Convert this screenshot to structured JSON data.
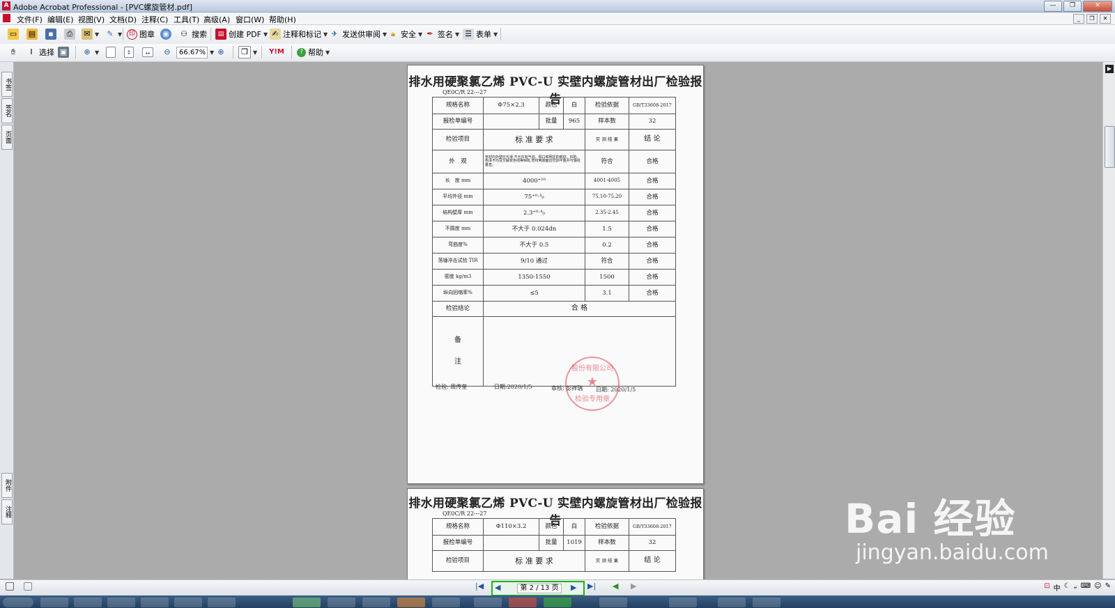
{
  "window": {
    "title": "Adobe Acrobat Professional - [PVC螺旋管材.pdf]"
  },
  "menu": [
    "文件(F)",
    "编辑(E)",
    "视图(V)",
    "文档(D)",
    "注释(C)",
    "工具(T)",
    "高级(A)",
    "窗口(W)",
    "帮助(H)"
  ],
  "toolbar1": {
    "stamp": "图章",
    "search": "搜索",
    "create_pdf": "创建 PDF",
    "comment": "注释和标记",
    "send_review": "发送供审阅",
    "security": "安全",
    "sign": "签名",
    "forms": "表单"
  },
  "toolbar2": {
    "select": "选择",
    "zoom": "66.67%",
    "help": "帮助"
  },
  "side_tabs": [
    "书签",
    "签名",
    "页面",
    "附件",
    "注释"
  ],
  "report1": {
    "title": "排水用硬聚氯乙烯 PVC-U 实壁内螺旋管材出厂检验报告",
    "code": "QE0C/R 22---27",
    "spec_label": "规格名称",
    "spec": "Φ75×2.3",
    "color_label": "颜色",
    "color": "白",
    "basis_label": "检验依据",
    "basis": "GB/T33608-2017",
    "form_no_label": "报检单编号",
    "batch_label": "批量",
    "batch": "965",
    "sample_label": "样本数",
    "sample": "32",
    "h_item": "检验项目",
    "h_req": "标 准 要 求",
    "h_result": "实 测 结 果",
    "h_conc": "结 论",
    "rows": [
      {
        "item": "外　观",
        "req": "管材内外壁应光滑,不允许有气泡、裂口和明显的痕纹、凹陷、色泽不均及分解变色线等缺陷,管材两端面应切割平整并与轴线垂直。",
        "result": "符合",
        "conc": "合格"
      },
      {
        "item": "长　度 mm",
        "req": "4000⁺¹⁰",
        "result": "4001-4005",
        "conc": "合格"
      },
      {
        "item": "平均外径 mm",
        "req": "75⁺⁰·³₀",
        "result": "75.10-75.20",
        "conc": "合格"
      },
      {
        "item": "结构壁厚 mm",
        "req": "2.3⁺⁰·⁴₀",
        "result": "2.35-2.45",
        "conc": "合格"
      },
      {
        "item": "不圆度 mm",
        "req": "不大于 0.024dn",
        "result": "1.5",
        "conc": "合格"
      },
      {
        "item": "弯曲度%",
        "req": "不大于 0.5",
        "result": "0.2",
        "conc": "合格"
      },
      {
        "item": "落锤冲击试验 TIR",
        "req": "9/10 通过",
        "result": "符合",
        "conc": "合格"
      },
      {
        "item": "密度 kg/m3",
        "req": "1350-1550",
        "result": "1500",
        "conc": "合格"
      },
      {
        "item": "纵向回缩率%",
        "req": "≤5",
        "result": "3.1",
        "conc": "合格"
      }
    ],
    "conclusion_label": "检验结论",
    "conclusion": "合 格",
    "remark_a": "备",
    "remark_b": "注",
    "inspector": "检验: 周传奎",
    "date1": "日期:2020/1/5",
    "reviewer": "审核: 彭祥瑞",
    "date2": "日期: 2020/1/5",
    "stamp_top": "股份有限公司",
    "stamp_bottom": "检验专用章"
  },
  "report2": {
    "title": "排水用硬聚氯乙烯 PVC-U 实壁内螺旋管材出厂检验报告",
    "code": "QE0C/R 22---27",
    "spec_label": "规格名称",
    "spec": "Φ110×3.2",
    "color_label": "颜色",
    "color": "白",
    "basis_label": "检验依据",
    "basis": "GB/T33608-2017",
    "form_no_label": "报检单编号",
    "batch_label": "批量",
    "batch": "1019",
    "sample_label": "样本数",
    "sample": "32",
    "h_item": "检验项目",
    "h_req": "标 准 要 求",
    "h_result": "实 测 结 果",
    "h_conc": "结 论"
  },
  "status": {
    "page": "第 2 / 13 页"
  },
  "watermark": {
    "brand": "Bai 经验",
    "url": "jingyan.baidu.com"
  },
  "tray": [
    "中",
    "„",
    "♪"
  ]
}
